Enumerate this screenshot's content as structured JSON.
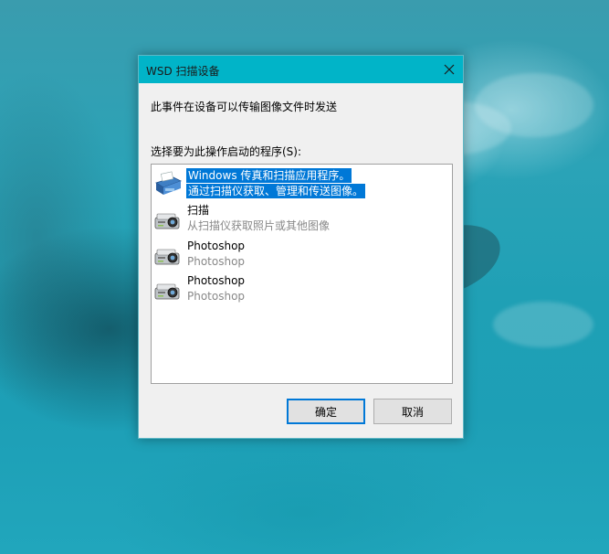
{
  "dialog": {
    "title": "WSD 扫描设备",
    "description": "此事件在设备可以传输图像文件时发送",
    "prompt": "选择要为此操作启动的程序(S):",
    "programs": [
      {
        "name": "Windows 传真和扫描应用程序。",
        "subtitle": "通过扫描仪获取、管理和传送图像。",
        "icon": "fax-scanner-icon",
        "selected": true
      },
      {
        "name": "扫描",
        "subtitle": "从扫描仪获取照片或其他图像",
        "icon": "camera-scanner-icon",
        "selected": false
      },
      {
        "name": "Photoshop",
        "subtitle": "Photoshop",
        "icon": "camera-scanner-icon",
        "selected": false
      },
      {
        "name": "Photoshop",
        "subtitle": "Photoshop",
        "icon": "camera-scanner-icon",
        "selected": false
      }
    ],
    "ok_label": "确定",
    "cancel_label": "取消"
  },
  "colors": {
    "titlebar": "#01b4c8",
    "selection": "#0078d7",
    "desktop": "#1fa0b5"
  }
}
